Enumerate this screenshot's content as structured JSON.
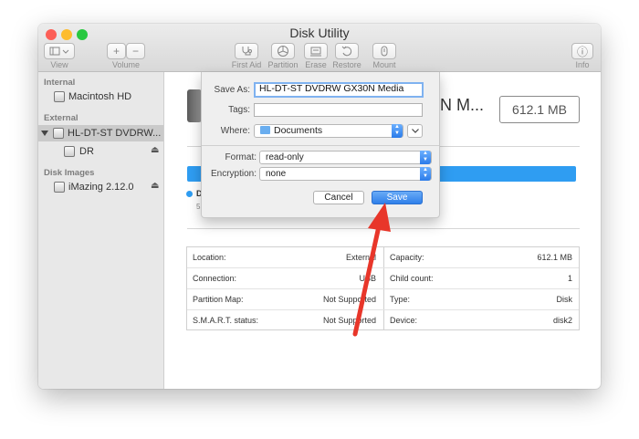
{
  "window": {
    "title": "Disk Utility"
  },
  "toolbar": {
    "view": "View",
    "volume": "Volume",
    "first_aid": "First Aid",
    "partition": "Partition",
    "erase": "Erase",
    "restore": "Restore",
    "mount": "Mount",
    "info": "Info",
    "add_glyph": "+",
    "remove_glyph": "−",
    "info_glyph": "ⓘ"
  },
  "sidebar": {
    "sections": [
      {
        "heading": "Internal",
        "items": [
          {
            "label": "Macintosh HD"
          }
        ]
      },
      {
        "heading": "External",
        "items": [
          {
            "label": "HL-DT-ST DVDRW..."
          },
          {
            "label": "DR"
          }
        ]
      },
      {
        "heading": "Disk Images",
        "items": [
          {
            "label": "iMazing 2.12.0"
          }
        ]
      }
    ],
    "eject_glyph": "⏏"
  },
  "main": {
    "heading_fragment": "N M...",
    "size": "612.1 MB",
    "legend_letter": "D",
    "legend_sub": "5"
  },
  "info_table": {
    "left": [
      {
        "label": "Location:",
        "value": "External"
      },
      {
        "label": "Connection:",
        "value": "USB"
      },
      {
        "label": "Partition Map:",
        "value": "Not Supported"
      },
      {
        "label": "S.M.A.R.T. status:",
        "value": "Not Supported"
      }
    ],
    "right": [
      {
        "label": "Capacity:",
        "value": "612.1 MB"
      },
      {
        "label": "Child count:",
        "value": "1"
      },
      {
        "label": "Type:",
        "value": "Disk"
      },
      {
        "label": "Device:",
        "value": "disk2"
      }
    ]
  },
  "save_dialog": {
    "save_as_label": "Save As:",
    "save_as_value": "HL-DT-ST DVDRW GX30N Media",
    "tags_label": "Tags:",
    "tags_value": "",
    "where_label": "Where:",
    "where_value": "Documents",
    "format_label": "Format:",
    "format_value": "read-only",
    "encryption_label": "Encryption:",
    "encryption_value": "none",
    "cancel": "Cancel",
    "save": "Save"
  },
  "colors": {
    "accent": "#2f9df2",
    "save_button": "#3b86f0",
    "annotation_arrow": "#e8362a"
  }
}
